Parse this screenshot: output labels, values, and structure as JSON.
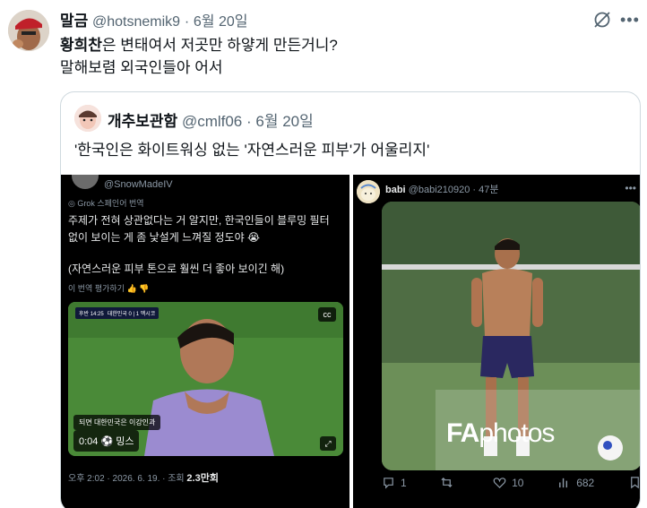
{
  "post": {
    "author_name": "말금",
    "handle": "@hotsnemik9",
    "separator": "·",
    "date": "6월 20일",
    "text_bold": "황희찬",
    "text_line1_rest": "은 변태여서 저곳만 하얗게 만든거니?",
    "text_line2": "말해보렴 외국인들아 어서",
    "icons": [
      "grok-icon",
      "more-icon"
    ]
  },
  "quote": {
    "author_name": "개추보관함",
    "handle": "@cmlf06",
    "separator": "·",
    "date": "6월 20일",
    "text": "'한국인은 화이트워싱 없는 '자연스러운 피부'가 어울리지'"
  },
  "media_left": {
    "handle": "@SnowMadeIV",
    "grok_label": "Grok 스페인어 번역",
    "text_line1": "주제가 전혀 상관없다는 거 알지만, 한국인들이 블루밍 필터",
    "text_line2": "없이 보이는 게 좀 낯설게 느껴질 정도야 😭",
    "text_line3": "(자연스러운 피부 톤으로 훨씬 더 좋아 보이긴 해)",
    "rate_label": "이 번역 평가하기",
    "video": {
      "scoreboard": "대한민국 0 | 1 멕시코",
      "score_tag": "후반 14:25",
      "subtitle": "되면 대한민국은 이강인과",
      "time": "0:04",
      "player_tag": "밍스"
    },
    "footer_time": "오후 2:02 · 2026. 6. 19. · 조회",
    "footer_views": "2.3만회"
  },
  "media_right": {
    "author_name": "babi",
    "handle": "@babi210920",
    "age": "47분",
    "watermark_bold": "FA",
    "watermark_rest": "photos",
    "actions": {
      "reply": "1",
      "retweet": "",
      "like": "10",
      "views": "682"
    }
  }
}
